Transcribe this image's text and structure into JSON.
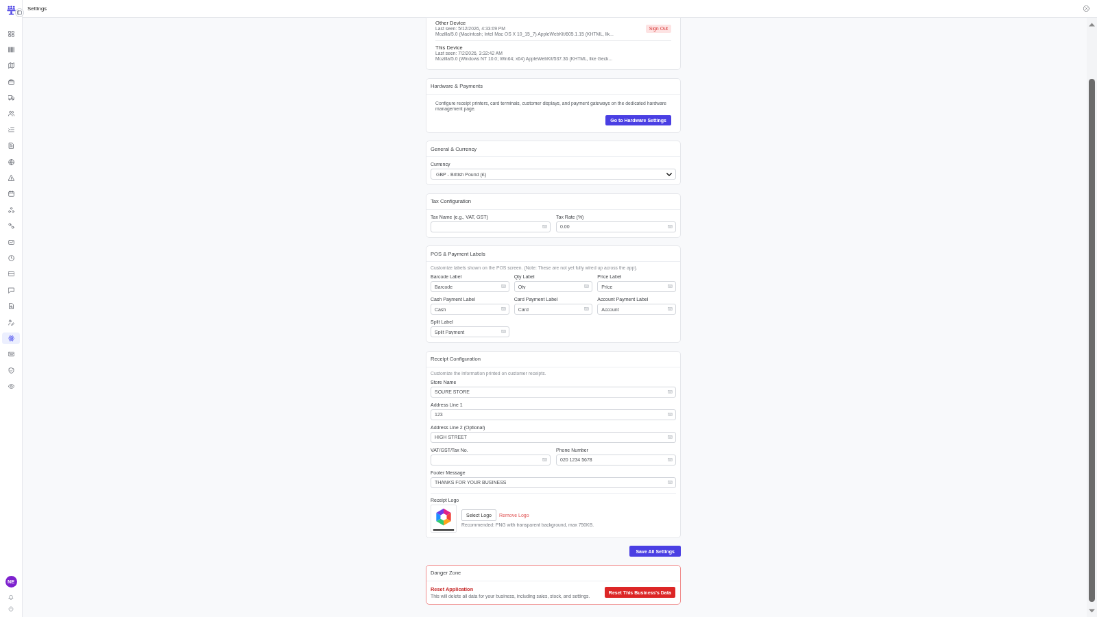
{
  "header": {
    "title": "Settings"
  },
  "sidebar": {
    "items": [
      {
        "selected": false
      },
      {
        "selected": false
      },
      {
        "selected": false
      },
      {
        "selected": false
      },
      {
        "selected": false
      },
      {
        "selected": false
      },
      {
        "selected": false
      },
      {
        "selected": false
      },
      {
        "selected": false
      },
      {
        "selected": false
      },
      {
        "selected": false
      },
      {
        "selected": false
      },
      {
        "selected": false
      },
      {
        "selected": false
      },
      {
        "selected": false
      },
      {
        "selected": false
      },
      {
        "selected": false
      },
      {
        "selected": false
      },
      {
        "selected": false
      },
      {
        "selected": true
      },
      {
        "selected": false
      },
      {
        "selected": false
      },
      {
        "selected": false
      }
    ],
    "user": {
      "initials": "NE"
    }
  },
  "sections": [
    {
      "kind": "devices",
      "devices": [
        {
          "name": "Other Device",
          "last_seen": "Last seen: 5/12/2026, 4:33:09 PM",
          "user_agent": "Mozilla/5.0 (Macintosh; Intel Mac OS X 10_15_7) AppleWebKit/605.1.15 (KHTML, lik...",
          "action": "Sign Out"
        },
        {
          "name": "This Device",
          "last_seen": "Last seen: 7/2/2026, 3:32:42 AM",
          "user_agent": "Mozilla/5.0 (Windows NT 10.0; Win64; x64) AppleWebKit/537.36 (KHTML, like Geck..."
        }
      ]
    },
    {
      "kind": "link",
      "title": "Hardware & Payments",
      "description": "Configure receipt printers, card terminals, customer displays, and payment gateways on the dedicated hardware management page.",
      "button": "Go to Hardware Settings"
    },
    {
      "kind": "form",
      "title": "General & Currency",
      "rows": [
        [
          {
            "kind": "select",
            "label": "Currency",
            "value": "GBP - British Pound (£)"
          }
        ]
      ]
    },
    {
      "kind": "form",
      "title": "Tax Configuration",
      "rows": [
        [
          {
            "kind": "text",
            "label": "Tax Name (e.g., VAT, GST)"
          },
          {
            "kind": "text",
            "label": "Tax Rate (%)",
            "value": "0.00"
          }
        ]
      ]
    },
    {
      "kind": "grid",
      "title": "POS & Payment Labels",
      "note": "Customize labels shown on the POS screen. (Note: These are not yet fully wired up across the app).",
      "fields": [
        {
          "kind": "text",
          "label": "Barcode Label",
          "value": "Barcode"
        },
        {
          "kind": "text",
          "label": "Qty Label",
          "value": "Qty"
        },
        {
          "kind": "text",
          "label": "Price Label",
          "value": "Price"
        },
        {
          "kind": "text",
          "label": "Cash Payment Label",
          "value": "Cash"
        },
        {
          "kind": "text",
          "label": "Card Payment Label",
          "value": "Card"
        },
        {
          "kind": "text",
          "label": "Account Payment Label",
          "value": "Account"
        },
        {
          "kind": "text",
          "label": "Split Label",
          "value": "Split Payment"
        }
      ]
    },
    {
      "kind": "form",
      "title": "Receipt Configuration",
      "note": "Customize the information printed on customer receipts.",
      "rows": [
        [
          {
            "kind": "text",
            "label": "Store Name",
            "value": "SQURE STORE"
          }
        ],
        [
          {
            "kind": "text",
            "label": "Address Line 1",
            "value": "123"
          }
        ],
        [
          {
            "kind": "text",
            "label": "Address Line 2 (Optional)",
            "value": "HIGH STREET"
          }
        ],
        [
          {
            "kind": "text",
            "label": "VAT/GST/Tax No."
          },
          {
            "kind": "text",
            "label": "Phone Number",
            "value": "020 1234 5678"
          }
        ],
        [
          {
            "kind": "text",
            "label": "Footer Message",
            "value": "THANKS FOR YOUR BUSINESS"
          }
        ]
      ],
      "logo": {
        "label": "Receipt Logo",
        "select_button": "Select Logo",
        "remove_link": "Remove Logo",
        "hint": "Recommended: PNG with transparent background, max 750KB."
      }
    }
  ],
  "save_button": "Save All Settings",
  "danger_zone": {
    "title": "Danger Zone",
    "heading": "Reset Application",
    "description": "This will delete all data for your business, including sales, stock, and settings.",
    "button": "Reset This Business's Data"
  }
}
